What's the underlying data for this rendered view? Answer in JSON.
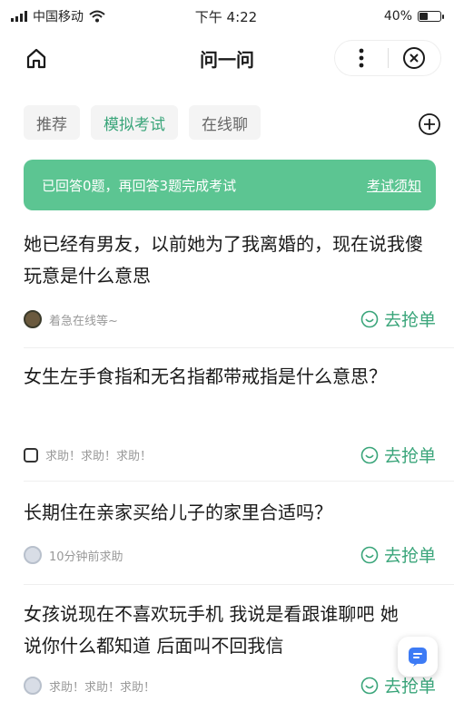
{
  "status_bar": {
    "carrier": "中国移动",
    "time": "下午 4:22",
    "battery": "40%",
    "battery_level": 0.4
  },
  "nav": {
    "title": "问一问"
  },
  "tabs": [
    "推荐",
    "模拟考试",
    "在线聊"
  ],
  "banner": {
    "text": "已回答0题，再回答3题完成考试",
    "link": "考试须知"
  },
  "questions": [
    {
      "title": "她已经有男友，以前她为了我离婚的，现在说我傻玩意是什么意思",
      "meta": "着急在线等~",
      "action": "去抢单"
    },
    {
      "title": "女生左手食指和无名指都带戒指是什么意思？",
      "meta": "求助！求助！求助！",
      "action": "去抢单"
    },
    {
      "title": "长期住在亲家买给儿子的家里合适吗？",
      "meta": "10分钟前求助",
      "action": "去抢单"
    },
    {
      "title": "女孩说现在不喜欢玩手机 我说是看跟谁聊吧 她说你什么都知道 后面叫不回我信",
      "meta": "求助！求助！求助！",
      "action": "去抢单"
    }
  ],
  "colors": {
    "accent": "#3aa57a",
    "banner_bg": "#5cc592"
  }
}
